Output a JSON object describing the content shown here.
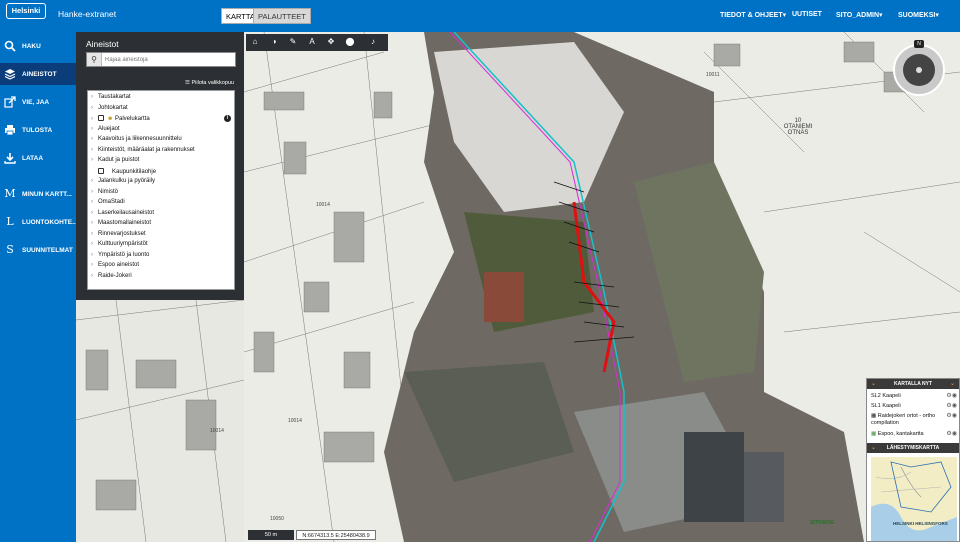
{
  "header": {
    "logo": "Helsinki",
    "app_title": "Hanke-extranet",
    "view_toggle": [
      "KARTTA",
      "PALAUTTEET"
    ],
    "nav": [
      {
        "label": "TIEDOT & OHJEET",
        "caret": "▾"
      },
      {
        "label": "UUTISET",
        "caret": ""
      },
      {
        "label": "SITO_ADMIN",
        "caret": "▾"
      },
      {
        "label": "SUOMEKSI",
        "caret": "▾"
      }
    ]
  },
  "sidebar": {
    "items": [
      {
        "label": "HAKU",
        "icon": "search-icon"
      },
      {
        "label": "AINEISTOT",
        "icon": "layers-icon",
        "active": true
      },
      {
        "label": "VIE, JAA",
        "icon": "share-icon"
      },
      {
        "label": "TULOSTA",
        "icon": "print-icon"
      },
      {
        "label": "LATAA",
        "icon": "download-icon"
      },
      {
        "label": "MINUN KARTT...",
        "icon": "M"
      },
      {
        "label": "LUONTOKOHTE...",
        "icon": "L"
      },
      {
        "label": "SUUNNITELMAT",
        "icon": "S"
      }
    ]
  },
  "layers_panel": {
    "title": "Aineistot",
    "search_placeholder": "Rajaa aineistoja",
    "hide_menu": "Piilota valikkopuu",
    "items": [
      {
        "label": "Taustakartat",
        "type": "group"
      },
      {
        "label": "Johtokartat",
        "type": "group"
      },
      {
        "label": "Palvelukartta",
        "type": "layer-with-icon",
        "checked": false
      },
      {
        "label": "Aluejaot",
        "type": "group"
      },
      {
        "label": "Kaavoitus ja liikennesuunnittelu",
        "type": "group"
      },
      {
        "label": "Kiinteistöt, määräalat ja rakennukset",
        "type": "group"
      },
      {
        "label": "Kadut ja puistot",
        "type": "group"
      },
      {
        "label": "Kaupunkitilaohje",
        "type": "layer",
        "checked": false
      },
      {
        "label": "Jalankulku ja pyöräily",
        "type": "group"
      },
      {
        "label": "Nimistö",
        "type": "group"
      },
      {
        "label": "OmaStadi",
        "type": "group"
      },
      {
        "label": "Laserkeilausaineistot",
        "type": "group"
      },
      {
        "label": "Maastomallaineistot",
        "type": "group"
      },
      {
        "label": "Rinnevarjostukset",
        "type": "group"
      },
      {
        "label": "Kulttuuriympäristöt",
        "type": "group"
      },
      {
        "label": "Ympäristö ja luonto",
        "type": "group"
      },
      {
        "label": "Espoo aineistot",
        "type": "group"
      },
      {
        "label": "Raide-Jokeri",
        "type": "group"
      }
    ]
  },
  "map": {
    "labels": [
      "10011",
      "10 OTANIEMI OTNÄS",
      "10014",
      "10014",
      "10050",
      "10014",
      "SITOWISE"
    ],
    "tools": [
      "home-icon",
      "contrast-icon",
      "pencil-icon",
      "text-icon",
      "move-icon",
      "location-icon",
      "microphone-icon"
    ],
    "compass_letter": "N",
    "scale": "50 m",
    "coordinates": "N:6674313.5 E:25480438.9"
  },
  "map_panel": {
    "current_title": "KARTALLA NYT",
    "current_layers": [
      {
        "label": "SL2 Kaapeli"
      },
      {
        "label": "SL1 Kaapeli"
      },
      {
        "label": "Raidejokeri ortot - ortho compilation"
      },
      {
        "label": "Espoo, kantakartta"
      }
    ],
    "overview_title": "LÄHESTYMISKARTTA",
    "overview_label": "HELSINKI HELSINGFORS"
  },
  "colors": {
    "header_blue": "#0072c6",
    "nav_active": "#0a3d7a",
    "panel_dark": "#2c2f33"
  }
}
